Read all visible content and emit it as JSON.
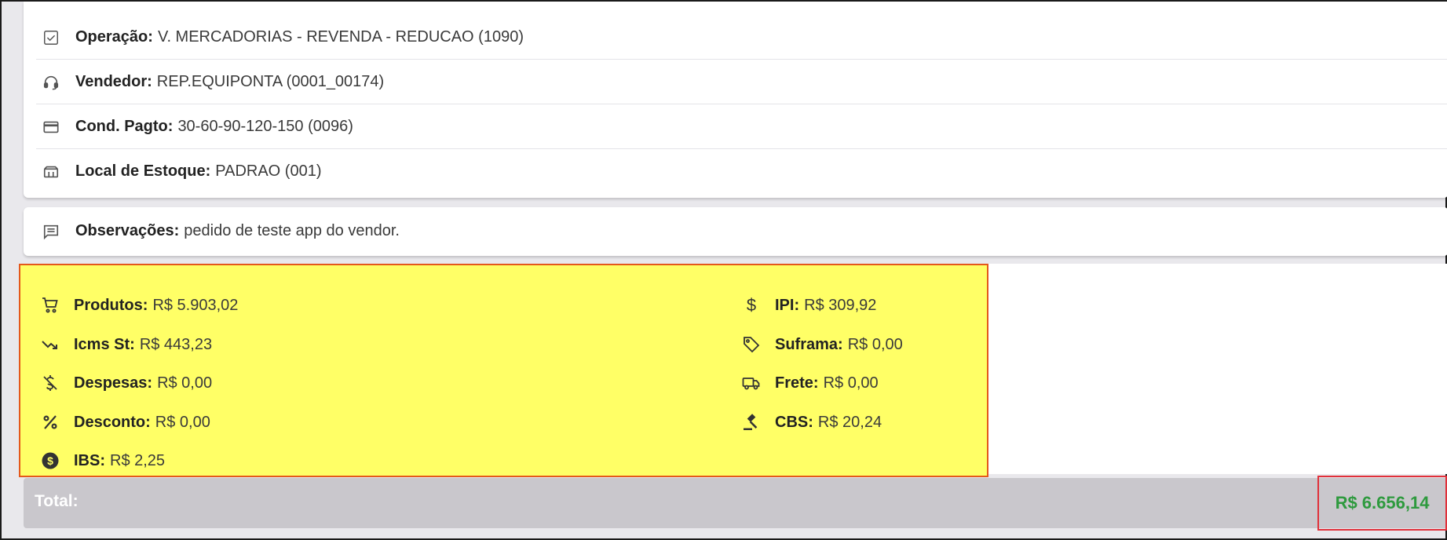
{
  "details": {
    "operacao": {
      "label": "Operação:",
      "value": "V. MERCADORIAS - REVENDA - REDUCAO (1090)",
      "icon": "checkbox-icon"
    },
    "vendedor": {
      "label": "Vendedor:",
      "value": "REP.EQUIPONTA (0001_00174)",
      "icon": "headset-icon"
    },
    "cond_pagto": {
      "label": "Cond. Pagto:",
      "value": "30-60-90-120-150 (0096)",
      "icon": "credit-card-icon"
    },
    "local_estoque": {
      "label": "Local de Estoque:",
      "value": "PADRAO (001)",
      "icon": "storefront-icon"
    }
  },
  "observacoes": {
    "label": "Observações:",
    "value": "pedido de teste app do vendor.",
    "icon": "comment-icon"
  },
  "summary": {
    "produtos": {
      "label": "Produtos:",
      "value": "R$ 5.903,02",
      "icon": "cart-icon"
    },
    "icms_st": {
      "label": "Icms St:",
      "value": "R$ 443,23",
      "icon": "trending-down-icon"
    },
    "despesas": {
      "label": "Despesas:",
      "value": "R$ 0,00",
      "icon": "money-off-icon"
    },
    "desconto": {
      "label": "Desconto:",
      "value": "R$ 0,00",
      "icon": "percent-icon"
    },
    "ibs": {
      "label": "IBS:",
      "value": "R$ 2,25",
      "icon": "dollar-circle-icon"
    },
    "ipi": {
      "label": "IPI:",
      "value": "R$ 309,92",
      "icon": "dollar-icon"
    },
    "suframa": {
      "label": "Suframa:",
      "value": "R$ 0,00",
      "icon": "tag-icon"
    },
    "frete": {
      "label": "Frete:",
      "value": "R$ 0,00",
      "icon": "truck-icon"
    },
    "cbs": {
      "label": "CBS:",
      "value": "R$ 20,24",
      "icon": "gavel-icon"
    }
  },
  "total": {
    "label": "Total:",
    "value": "R$ 6.656,14"
  },
  "colors": {
    "highlight": "#ffff66",
    "highlight_border": "#e4581b",
    "total_value": "#2e9a3e",
    "total_border": "#e0303a",
    "total_bar": "#c9c7cc"
  }
}
